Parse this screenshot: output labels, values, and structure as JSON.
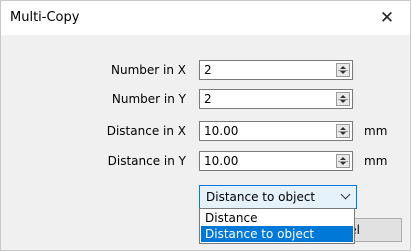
{
  "window": {
    "title": "Multi-Copy",
    "close_glyph": "✕",
    "close_icon": "close-icon"
  },
  "fields": [
    {
      "label": "Number in X",
      "value": "2",
      "unit": ""
    },
    {
      "label": "Number in Y",
      "value": "2",
      "unit": ""
    },
    {
      "label": "Distance in X",
      "value": "10.00",
      "unit": "mm"
    },
    {
      "label": "Distance in Y",
      "value": "10.00",
      "unit": "mm"
    }
  ],
  "mode_select": {
    "selected": "Distance to object",
    "options": [
      "Distance",
      "Distance to object"
    ]
  },
  "cancel_button": {
    "label_visible": "ncel"
  },
  "colors": {
    "highlight": "#0078d7",
    "dialog_bg": "#f0f0f0"
  }
}
